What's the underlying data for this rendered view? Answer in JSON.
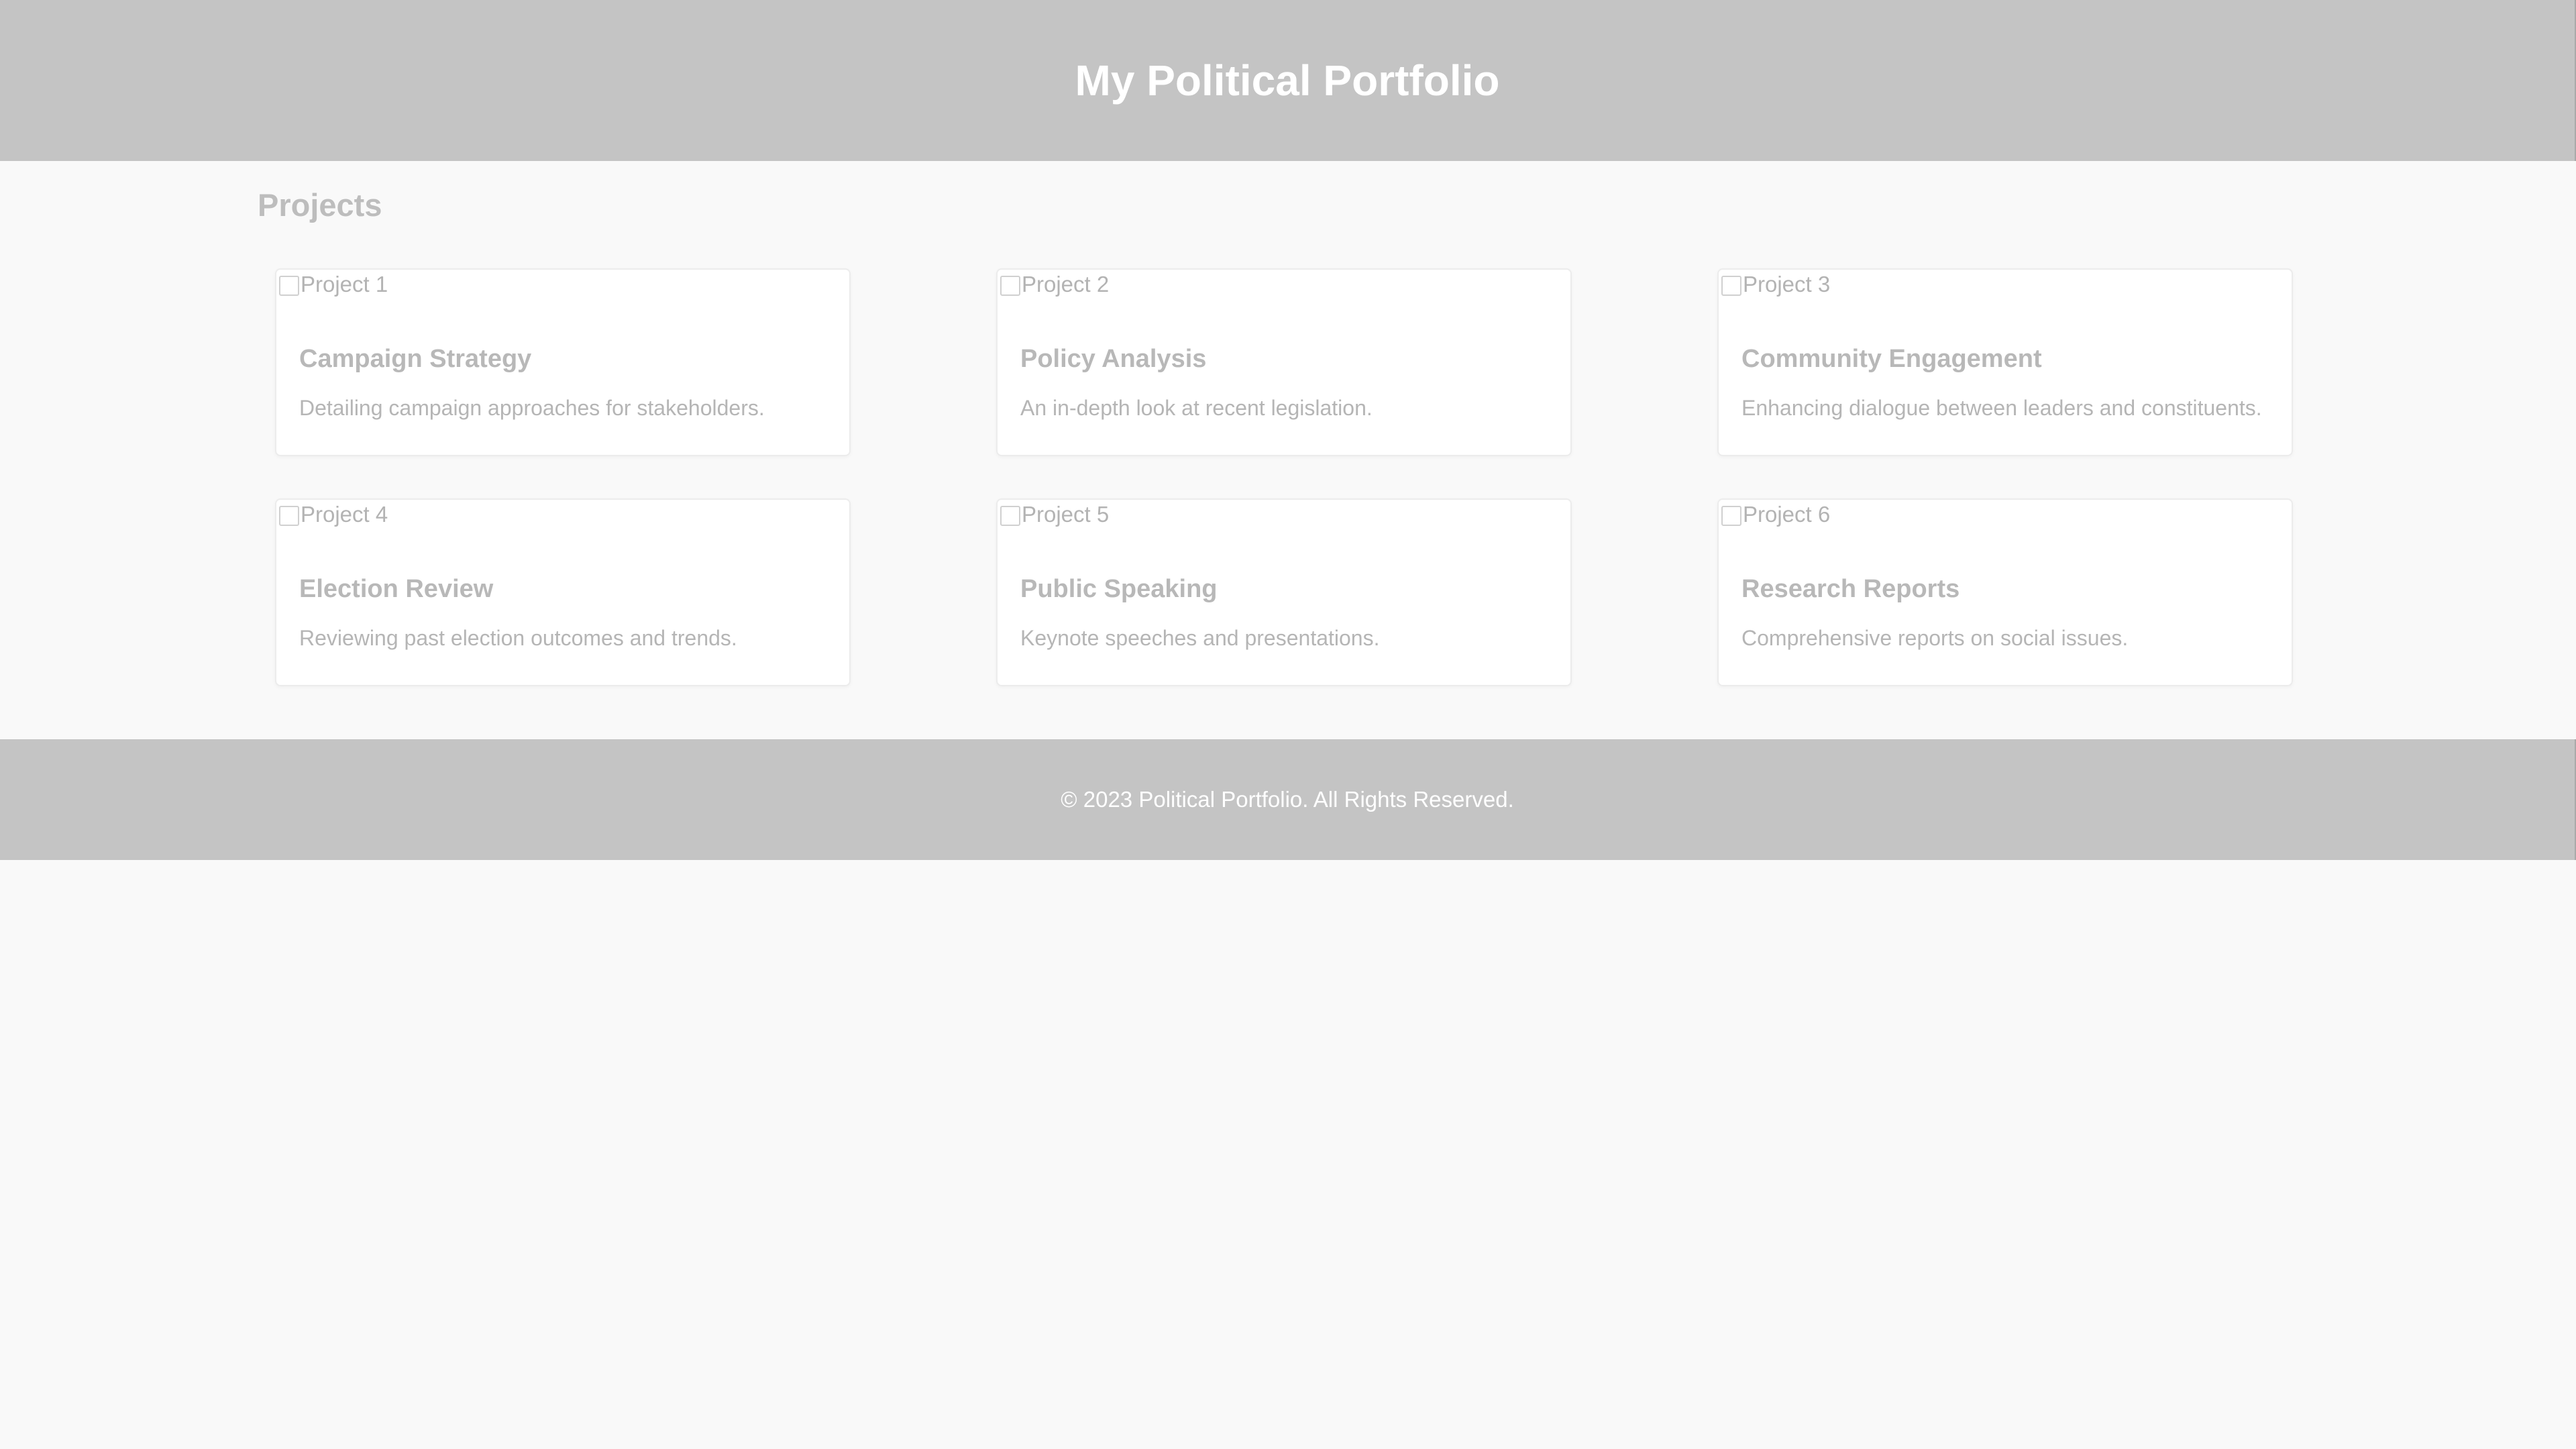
{
  "header": {
    "title": "My Political Portfolio"
  },
  "projects_section": {
    "title": "Projects",
    "cards": [
      {
        "image_alt": "Project 1",
        "title": "Campaign Strategy",
        "description": "Detailing campaign approaches for stakeholders."
      },
      {
        "image_alt": "Project 2",
        "title": "Policy Analysis",
        "description": "An in-depth look at recent legislation."
      },
      {
        "image_alt": "Project 3",
        "title": "Community Engagement",
        "description": "Enhancing dialogue between leaders and constituents."
      },
      {
        "image_alt": "Project 4",
        "title": "Election Review",
        "description": "Reviewing past election outcomes and trends."
      },
      {
        "image_alt": "Project 5",
        "title": "Public Speaking",
        "description": "Keynote speeches and presentations."
      },
      {
        "image_alt": "Project 6",
        "title": "Research Reports",
        "description": "Comprehensive reports on social issues."
      }
    ]
  },
  "footer": {
    "text": "© 2023 Political Portfolio. All Rights Reserved."
  },
  "colors": {
    "header_bg": "#c4c4c4",
    "page_bg": "#f9f9f9",
    "card_bg": "#ffffff",
    "footer_bg": "#c4c4c4"
  },
  "icons": {
    "card_image": "broken-image-icon"
  }
}
